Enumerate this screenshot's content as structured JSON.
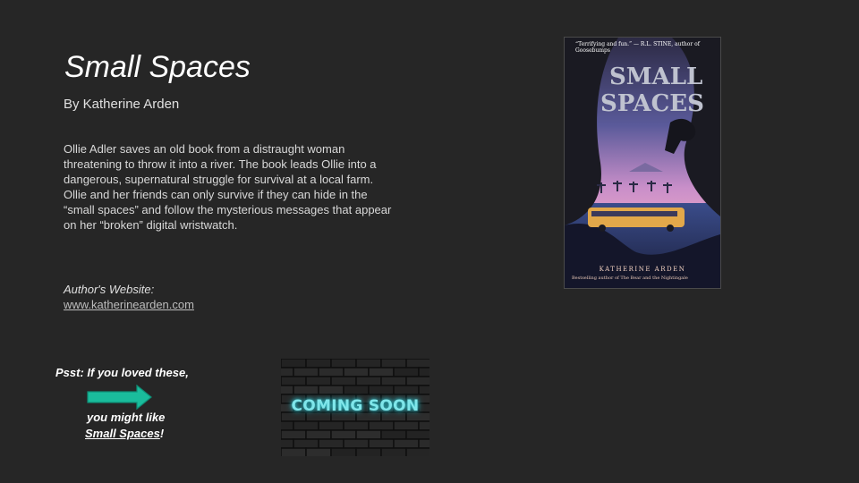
{
  "book": {
    "title": "Small Spaces",
    "byline": "By Katherine Arden",
    "description": "Ollie Adler saves an old book from a distraught woman threatening to throw it into a river. The book leads Ollie into a dangerous, supernatural struggle for survival at a local farm.  Ollie and her friends can only survive if they can hide in the “small spaces” and follow the mysterious messages that appear on her “broken” digital wristwatch."
  },
  "website": {
    "label": "Author's Website:",
    "url": "www.katherinearden.com"
  },
  "promo": {
    "psst": "Psst: If you loved these,",
    "like_prefix": "you might like",
    "like_title": "Small Spaces",
    "like_suffix": "!",
    "arrow_color": "#1abc9c"
  },
  "cover": {
    "quote": "“Terrifying and fun.” — R.L. STINE, author of Goosebumps",
    "art_title_line1": "SMALL",
    "art_title_line2": "SPACES",
    "author": "KATHERINE ARDEN",
    "subline": "Bestselling author of The Bear and the Nightingale"
  },
  "coming_soon": {
    "text": "COMING SOON"
  }
}
